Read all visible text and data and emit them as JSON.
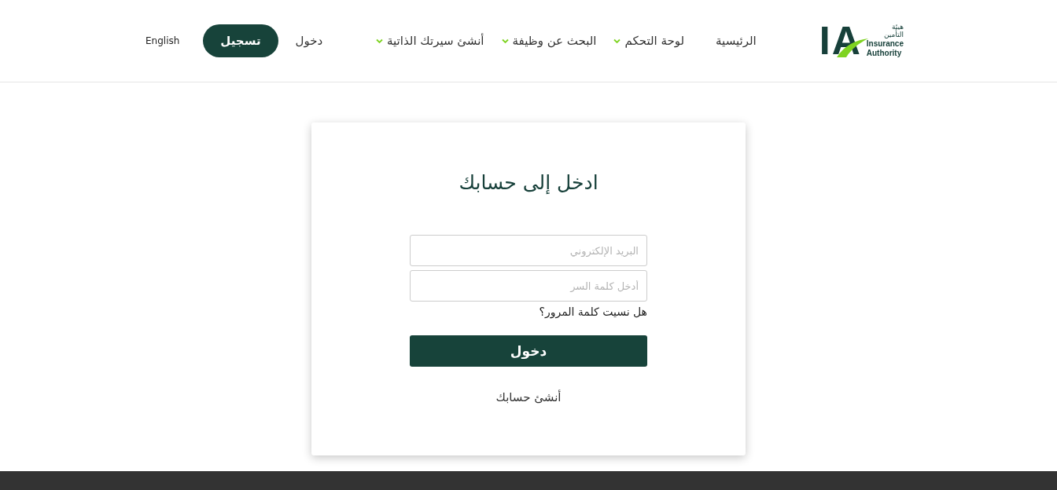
{
  "logo": {
    "mark": "IA",
    "arabic_lines": [
      "هيئة",
      "التأمين"
    ],
    "english_lines": [
      "Insurance",
      "Authority"
    ]
  },
  "nav": [
    {
      "label": "الرئيسية",
      "has_menu": false
    },
    {
      "label": "لوحة التحكم",
      "has_menu": true
    },
    {
      "label": "البحث عن وظيفة",
      "has_menu": true
    },
    {
      "label": "أنشئ سيرتك الذاتية",
      "has_menu": true
    }
  ],
  "auth": {
    "login": "دخول",
    "register": "تسجيل",
    "language": "English"
  },
  "login_card": {
    "title": "ادخل إلى حسابك",
    "email": {
      "placeholder": "البريد الإلكتروني"
    },
    "password": {
      "placeholder": "أدخل كلمة السر"
    },
    "forgot": "هل نسيت كلمة المرور؟",
    "submit": "دخول",
    "create_account": "أنشئ حسابك"
  }
}
